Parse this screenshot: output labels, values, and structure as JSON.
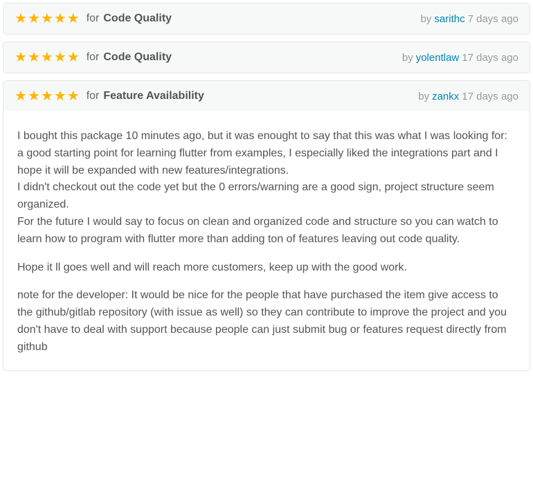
{
  "labels": {
    "for": "for",
    "by": "by"
  },
  "reviews": [
    {
      "stars": 5,
      "category": "Code Quality",
      "author": "sarithc",
      "time_ago": "7 days ago",
      "body": null
    },
    {
      "stars": 5,
      "category": "Code Quality",
      "author": "yolentlaw",
      "time_ago": "17 days ago",
      "body": null
    },
    {
      "stars": 5,
      "category": "Feature Availability",
      "author": "zankx",
      "time_ago": "17 days ago",
      "body": [
        "I bought this package 10 minutes ago, but it was enought to say that this was what I was looking for: a good starting point for learning flutter from examples, I especially liked the integrations part and I hope it will be expanded with new features/integrations.\nI didn't checkout out the code yet but the 0 errors/warning are a good sign, project structure seem organized.\nFor the future I would say to focus on clean and organized code and structure so you can watch to learn how to program with flutter more than adding ton of features leaving out code quality.",
        "Hope it ll goes well and will reach more customers, keep up with the good work.",
        "note for the developer: It would be nice for the people that have purchased the item give access to the github/gitlab repository (with issue as well) so they can contribute to improve the project and you don't have to deal with support because people can just submit bug or features request directly from github"
      ]
    }
  ]
}
